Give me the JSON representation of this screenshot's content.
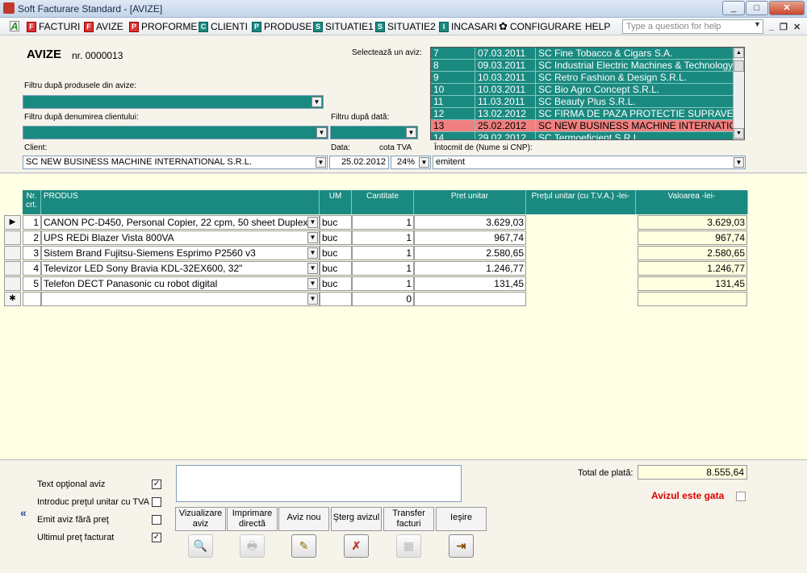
{
  "window": {
    "title": "Soft Facturare Standard - [AVIZE]",
    "min": "_",
    "max": "□",
    "close": "✕"
  },
  "menu": {
    "items": [
      {
        "label": "FACTURI",
        "icon": "F"
      },
      {
        "label": "AVIZE",
        "icon": "F"
      },
      {
        "label": "PROFORME",
        "icon": "P"
      },
      {
        "label": "CLIENTI",
        "icon": "C"
      },
      {
        "label": "PRODUSE",
        "icon": "P"
      },
      {
        "label": "SITUATIE1",
        "icon": "S"
      },
      {
        "label": "SITUATIE2",
        "icon": "S"
      },
      {
        "label": "INCASARI",
        "icon": "I"
      },
      {
        "label": "CONFIGURARE",
        "icon": "✿"
      },
      {
        "label": "HELP",
        "icon": ""
      }
    ],
    "app_icon": "A",
    "help_placeholder": "Type a question for help",
    "mdi_min": "_",
    "mdi_restore": "❐",
    "mdi_close": "✕"
  },
  "header": {
    "title": "AVIZE",
    "number": "nr. 0000013",
    "select_label": "Selectează un aviz:",
    "filter_products_label": "Filtru după produsele din avize:",
    "filter_client_label": "Filtru după denumirea clientului:",
    "filter_date_label": "Filtru după dată:",
    "client_label": "Client:",
    "date_label": "Data:",
    "vat_label": "cota TVA",
    "drafted_label": "Întocmit de (Nume si CNP):",
    "client_value": "SC NEW BUSINESS MACHINE INTERNATIONAL S.R.L.",
    "date_value": "25.02.2012",
    "vat_value": "24%",
    "drafted_value": "emitent"
  },
  "aviz_list": [
    {
      "nr": "7",
      "date": "07.03.2011",
      "client": "SC Fine Tobacco & Cigars S.A."
    },
    {
      "nr": "8",
      "date": "09.03.2011",
      "client": "SC Industrial Electric Machines & Technology"
    },
    {
      "nr": "9",
      "date": "10.03.2011",
      "client": "SC Retro Fashion & Design S.R.L."
    },
    {
      "nr": "10",
      "date": "10.03.2011",
      "client": "SC Bio Agro Concept S.R.L."
    },
    {
      "nr": "11",
      "date": "11.03.2011",
      "client": "SC Beauty Plus S.R.L."
    },
    {
      "nr": "12",
      "date": "13.02.2012",
      "client": "SC FIRMA DE PAZA PROTECTIE SUPRAVEGH"
    },
    {
      "nr": "13",
      "date": "25.02.2012",
      "client": "SC NEW BUSINESS MACHINE INTERNATIONA"
    },
    {
      "nr": "14",
      "date": "29.02.2012",
      "client": "SC Termoeficient S.R.L."
    }
  ],
  "grid": {
    "columns": {
      "nr": "Nr. crt.",
      "produs": "PRODUS",
      "um": "UM",
      "cantitate": "Cantitate",
      "pret": "Pret unitar",
      "pret_tva": "Preţul unitar (cu T.V.A.) -lei-",
      "valoare": "Valoarea -lei-"
    },
    "rows": [
      {
        "nr": "1",
        "produs": "CANON PC-D450, Personal Copier, 22 cpm, 50 sheet Duplex",
        "um": "buc",
        "cantitate": "1",
        "pret": "3.629,03",
        "valoare": "3.629,03"
      },
      {
        "nr": "2",
        "produs": "UPS REDi Blazer Vista 800VA",
        "um": "buc",
        "cantitate": "1",
        "pret": "967,74",
        "valoare": "967,74"
      },
      {
        "nr": "3",
        "produs": "Sistem Brand Fujitsu-Siemens Esprimo P2560 v3",
        "um": "buc",
        "cantitate": "1",
        "pret": "2.580,65",
        "valoare": "2.580,65"
      },
      {
        "nr": "4",
        "produs": "Televizor LED Sony Bravia KDL-32EX600, 32\"",
        "um": "buc",
        "cantitate": "1",
        "pret": "1.246,77",
        "valoare": "1.246,77"
      },
      {
        "nr": "5",
        "produs": "Telefon DECT Panasonic cu robot digital",
        "um": "buc",
        "cantitate": "1",
        "pret": "131,45",
        "valoare": "131,45"
      }
    ],
    "new_row_qty": "0",
    "current_marker": "▶",
    "new_marker": "✱"
  },
  "footer": {
    "options": [
      {
        "label": "Text opţional aviz",
        "checked": true
      },
      {
        "label": "Introduc preţul unitar cu TVA",
        "checked": false
      },
      {
        "label": "Emit aviz fără preţ",
        "checked": false
      },
      {
        "label": "Ultimul preţ facturat",
        "checked": true
      }
    ],
    "collapse": "«",
    "buttons": [
      {
        "label": "Vizualizare aviz",
        "icon": "🔍"
      },
      {
        "label": "Imprimare directă",
        "icon": "🖶"
      },
      {
        "label": "Aviz nou",
        "icon": "✎"
      },
      {
        "label": "Şterg avizul",
        "icon": "✗"
      },
      {
        "label": "Transfer facturi",
        "icon": "▦"
      },
      {
        "label": "Ieşire",
        "icon": "⇥"
      }
    ],
    "total_label": "Total de plată:",
    "total_value": "8.555,64",
    "gata_label": "Avizul este gata"
  }
}
